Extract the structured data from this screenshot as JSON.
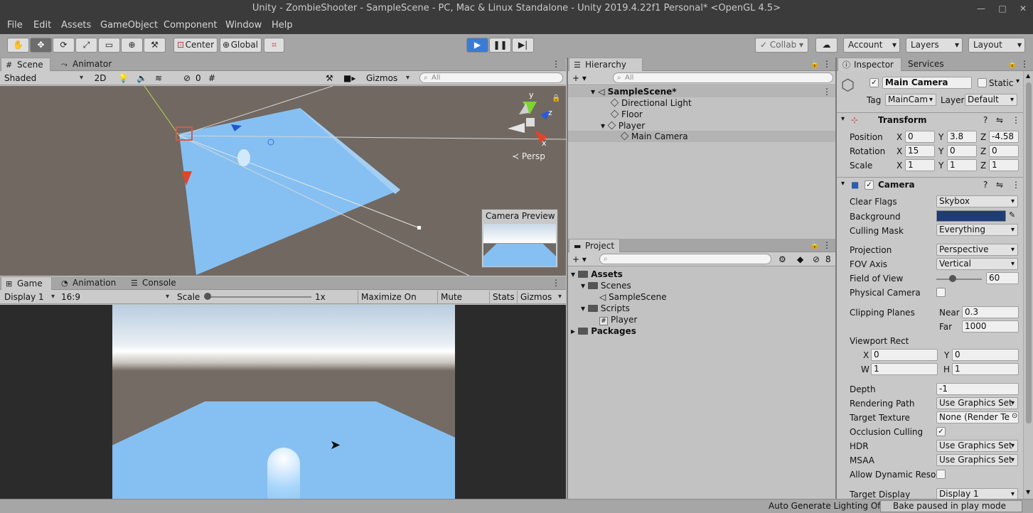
{
  "window": {
    "title": "Unity - ZombieShooter - SampleScene - PC, Mac & Linux Standalone - Unity 2019.4.22f1 Personal* <OpenGL 4.5>"
  },
  "menu": [
    "File",
    "Edit",
    "Assets",
    "GameObject",
    "Component",
    "Window",
    "Help"
  ],
  "toolbar": {
    "pivot": "Center",
    "space": "Global",
    "collab": "Collab",
    "account": "Account",
    "layers": "Layers",
    "layout": "Layout"
  },
  "scene_panel": {
    "tabs": [
      "Scene",
      "Animator"
    ],
    "shading": "Shaded",
    "mode_2d": "2D",
    "hidden_count": "0",
    "gizmos": "Gizmos",
    "search_placeholder": "All",
    "persp_label": "Persp",
    "camera_preview_title": "Camera Preview",
    "gizmo_axes": {
      "y": "y",
      "z": "z",
      "x": "x"
    }
  },
  "game_panel": {
    "tabs": [
      "Game",
      "Animation",
      "Console"
    ],
    "display": "Display 1",
    "aspect": "16:9",
    "scale_label": "Scale",
    "scale_value": "1x",
    "maximize": "Maximize On Play",
    "mute": "Mute Audio",
    "stats": "Stats",
    "gizmos": "Gizmos"
  },
  "hierarchy": {
    "tab": "Hierarchy",
    "search_placeholder": "All",
    "items": [
      {
        "label": "SampleScene*"
      },
      {
        "label": "Directional Light"
      },
      {
        "label": "Floor"
      },
      {
        "label": "Player"
      },
      {
        "label": "Main Camera"
      }
    ]
  },
  "project": {
    "tab": "Project",
    "hidden_count": "8",
    "tree": [
      {
        "label": "Assets"
      },
      {
        "label": "Scenes"
      },
      {
        "label": "SampleScene"
      },
      {
        "label": "Scripts"
      },
      {
        "label": "Player"
      },
      {
        "label": "Packages"
      }
    ]
  },
  "inspector": {
    "tabs": [
      "Inspector",
      "Services"
    ],
    "object_name": "Main Camera",
    "static_label": "Static",
    "tag_label": "Tag",
    "tag_value": "MainCam",
    "layer_label": "Layer",
    "layer_value": "Default",
    "transform": {
      "title": "Transform",
      "position_label": "Position",
      "rotation_label": "Rotation",
      "scale_label": "Scale",
      "position": [
        "0",
        "3.8",
        "-4.58"
      ],
      "rotation": [
        "15",
        "0",
        "0"
      ],
      "scale": [
        "1",
        "1",
        "1"
      ],
      "axes": [
        "X",
        "Y",
        "Z"
      ]
    },
    "camera": {
      "title": "Camera",
      "rows": [
        {
          "label": "Clear Flags",
          "value": "Skybox"
        },
        {
          "label": "Background",
          "value": ""
        },
        {
          "label": "Culling Mask",
          "value": "Everything"
        },
        {
          "label": "Projection",
          "value": "Perspective"
        },
        {
          "label": "FOV Axis",
          "value": "Vertical"
        },
        {
          "label": "Field of View",
          "value": "60"
        },
        {
          "label": "Physical Camera",
          "value": ""
        },
        {
          "label": "Clipping Planes",
          "value": ""
        },
        {
          "label": "Viewport Rect",
          "value": ""
        },
        {
          "label": "Depth",
          "value": "-1"
        },
        {
          "label": "Rendering Path",
          "value": "Use Graphics Set"
        },
        {
          "label": "Target Texture",
          "value": "None (Render Te"
        },
        {
          "label": "Occlusion Culling",
          "value": ""
        },
        {
          "label": "HDR",
          "value": "Use Graphics Set"
        },
        {
          "label": "MSAA",
          "value": "Use Graphics Set"
        },
        {
          "label": "Allow Dynamic Resol",
          "value": ""
        },
        {
          "label": "Target Display",
          "value": "Display 1"
        }
      ],
      "near_label": "Near",
      "near": "0.3",
      "far_label": "Far",
      "far": "1000",
      "viewport": {
        "x": "0",
        "y": "0",
        "w": "1",
        "h": "1"
      },
      "viewport_labels": [
        "X",
        "Y",
        "W",
        "H"
      ],
      "background_color": "#1f3d73"
    }
  },
  "status": {
    "lighting": "Auto Generate Lighting Off",
    "bake": "Bake paused in play mode"
  },
  "colors": {
    "accent": "#3a7bd5",
    "floor": "#86c0f2",
    "ground": "#716861"
  }
}
